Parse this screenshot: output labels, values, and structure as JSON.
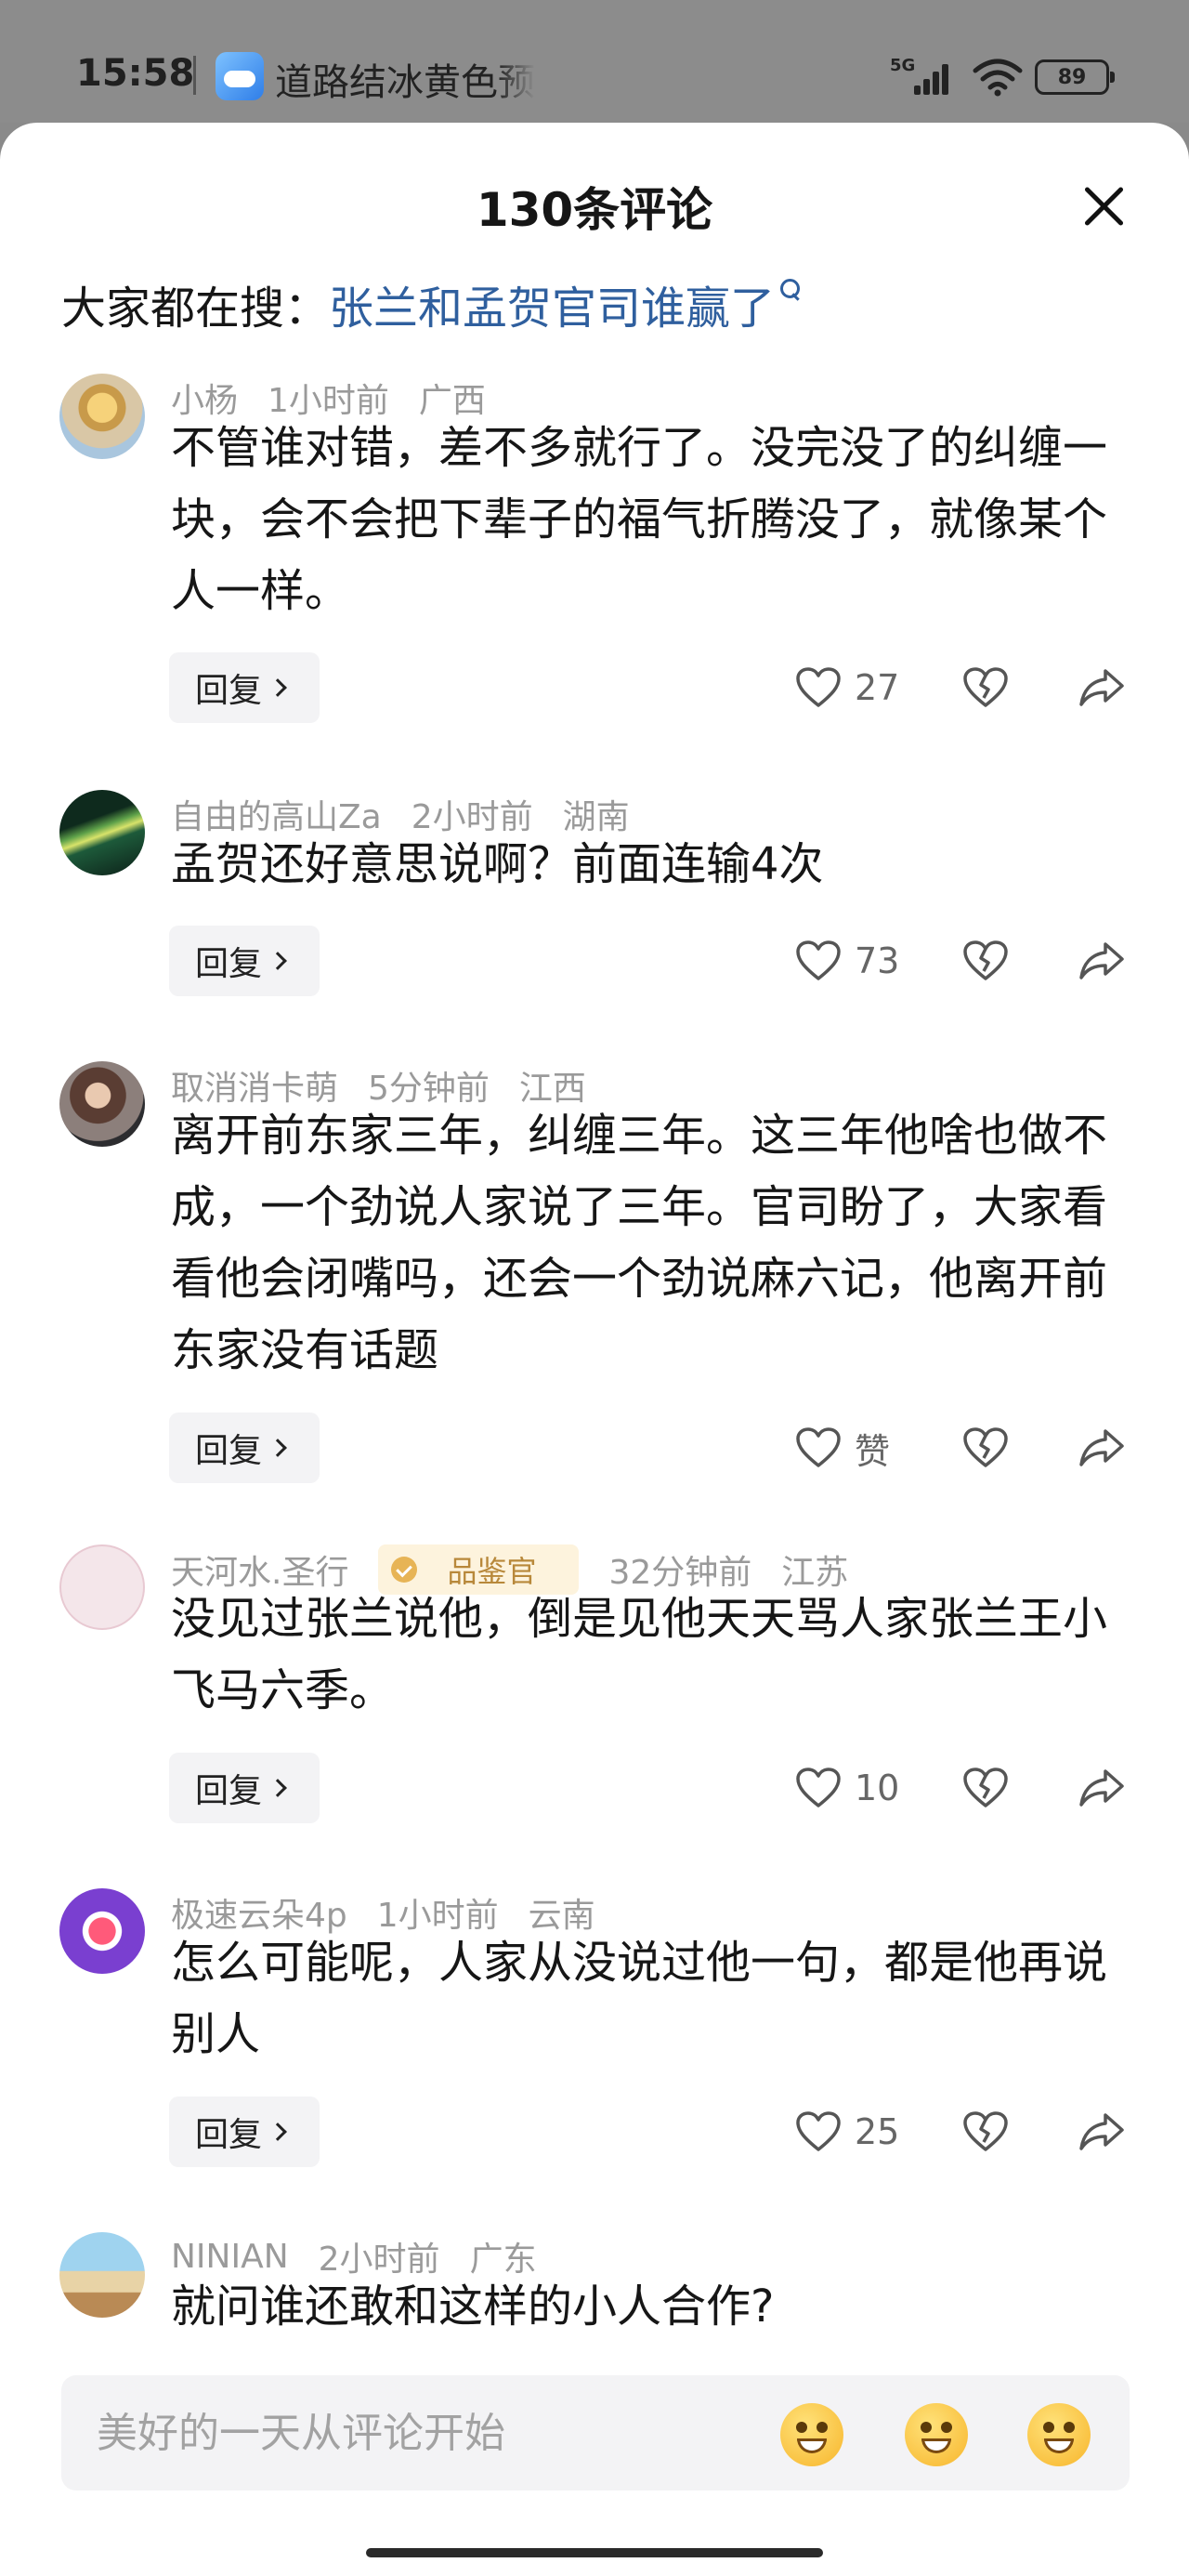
{
  "status_bar": {
    "time": "15:58",
    "notification": "道路结冰黄色预警",
    "network": "5G",
    "battery": "89"
  },
  "sheet": {
    "title": "130条评论",
    "search_label": "大家都在搜：",
    "search_query": "张兰和孟贺官司谁赢了"
  },
  "comments": [
    {
      "user": "小杨",
      "time": "1小时前",
      "location": "广西",
      "text": "不管谁对错，差不多就行了。没完没了的纠缠一块，会不会把下辈子的福气折腾没了，就像某个人一样。",
      "likes": "27",
      "reply_label": "回复"
    },
    {
      "user": "自由的高山Za",
      "time": "2小时前",
      "location": "湖南",
      "text": "孟贺还好意思说啊？前面连输4次",
      "likes": "73",
      "reply_label": "回复"
    },
    {
      "user": "取消消卡萌",
      "time": "5分钟前",
      "location": "江西",
      "text": "离开前东家三年，纠缠三年。这三年他啥也做不成，一个劲说人家说了三年。官司盼了，大家看看他会闭嘴吗，还会一个劲说麻六记，他离开前东家没有话题",
      "likes": "赞",
      "reply_label": "回复"
    },
    {
      "user": "天河水.圣行",
      "badge": "品鉴官",
      "time": "32分钟前",
      "location": "江苏",
      "text": "没见过张兰说他，倒是见他天天骂人家张兰王小飞马六季。",
      "likes": "10",
      "reply_label": "回复"
    },
    {
      "user": "极速云朵4p",
      "time": "1小时前",
      "location": "云南",
      "text": "怎么可能呢，人家从没说过他一句，都是他再说别人",
      "likes": "25",
      "reply_label": "回复"
    },
    {
      "user": "NINIAN",
      "time": "2小时前",
      "location": "广东",
      "text": "就问谁还敢和这样的小人合作?"
    }
  ],
  "input": {
    "placeholder": "美好的一天从评论开始"
  },
  "colors": {
    "link": "#2f5f9e",
    "meta": "#9a9a9a",
    "badge_bg": "#fdf3dd",
    "badge_text": "#b8883a"
  },
  "icons": [
    "close-icon",
    "search-icon",
    "heart-icon",
    "broken-heart-icon",
    "share-icon",
    "emoji-icon"
  ]
}
